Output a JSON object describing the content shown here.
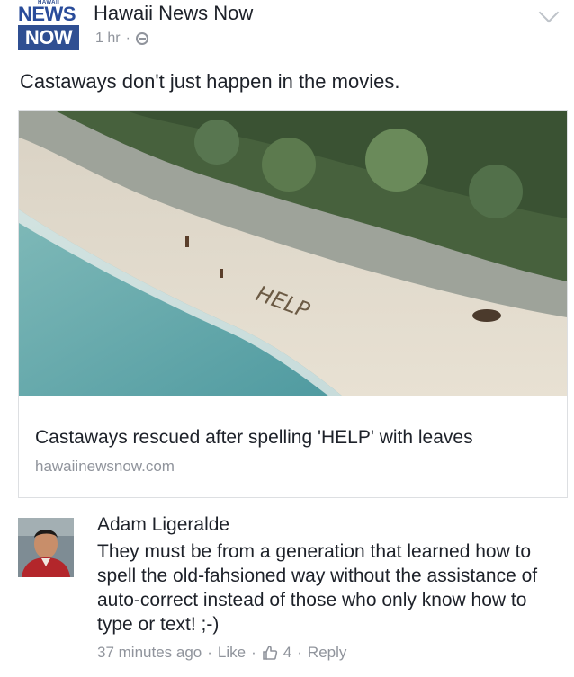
{
  "header": {
    "logo": {
      "tiny": "HAWAII",
      "news": "NEWS",
      "now": "NOW"
    },
    "page_name": "Hawaii News Now",
    "time": "1 hr",
    "dot": "·"
  },
  "post": {
    "text": "Castaways don't just happen in the movies.",
    "link_card": {
      "image_text": "HELP",
      "title": "Castaways rescued after spelling 'HELP' with leaves",
      "domain": "hawaiinewsnow.com"
    }
  },
  "comment": {
    "author": "Adam Ligeralde",
    "text": "They must be from a generation that learned how to spell the old-fahsioned way without the assistance of auto-correct instead of those who only know how to type or text! ;-)",
    "time": "37 minutes ago",
    "like_label": "Like",
    "like_count": "4",
    "reply_label": "Reply",
    "dot": "·"
  },
  "icons": [
    "globe-icon",
    "chevron-down-icon",
    "thumbs-up-icon"
  ],
  "colors": {
    "brand": "#2f4f92",
    "meta": "#90949c",
    "text": "#1d2129"
  }
}
